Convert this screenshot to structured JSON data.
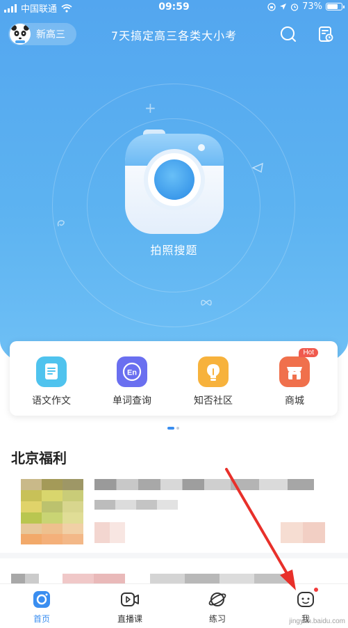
{
  "status_bar": {
    "carrier": "中国联通",
    "time": "09:59",
    "battery": "73%"
  },
  "header": {
    "grade": "新高三",
    "title": "7天搞定高三各类大小考",
    "icons": [
      "search-icon",
      "study-plan-icon"
    ]
  },
  "hero": {
    "camera_label": "拍照搜题",
    "icon": "camera-icon"
  },
  "shortcuts": [
    {
      "label": "语文作文",
      "icon": "document-icon",
      "color": "#4fc3ee"
    },
    {
      "label": "单词查询",
      "icon": "en-dictionary-icon",
      "color": "#6a6ff0"
    },
    {
      "label": "知否社区",
      "icon": "lightbulb-icon",
      "color": "#f7b23c"
    },
    {
      "label": "商城",
      "icon": "shop-icon",
      "color": "#f0704c",
      "badge": "Hot"
    }
  ],
  "section": {
    "title": "北京福利"
  },
  "bottom_nav": [
    {
      "label": "首页",
      "icon": "home-icon",
      "active": true
    },
    {
      "label": "直播课",
      "icon": "live-video-icon",
      "active": false
    },
    {
      "label": "练习",
      "icon": "planet-icon",
      "active": false
    },
    {
      "label": "我",
      "icon": "profile-icon",
      "active": false,
      "dot": true
    }
  ],
  "colors": {
    "primary": "#3a8ef0",
    "hero_top": "#53a6ef",
    "hero_bottom": "#72c2f6",
    "annotation_arrow": "#e8302a"
  },
  "watermark": "jingyan.baidu.com"
}
